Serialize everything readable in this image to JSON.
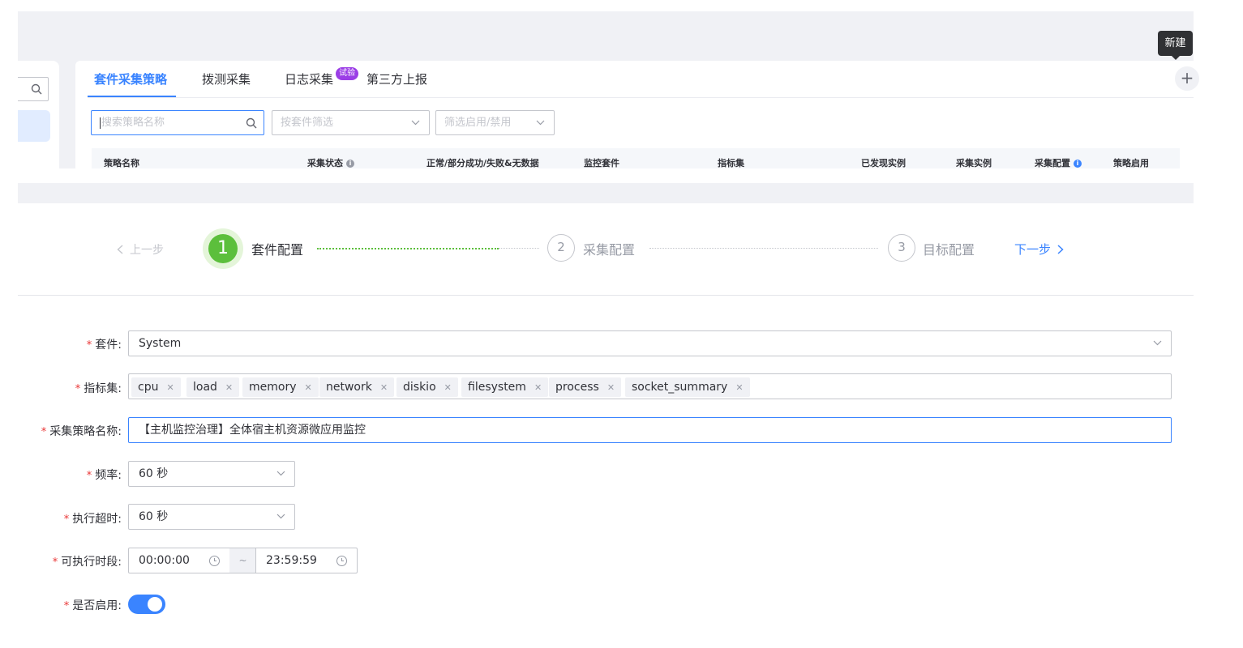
{
  "tooltip": {
    "new": "新建"
  },
  "tabs": [
    {
      "label": "套件采集策略"
    },
    {
      "label": "拨测采集"
    },
    {
      "label": "日志采集"
    },
    {
      "label": "第三方上报"
    }
  ],
  "trial_badge": "试验",
  "plus": "+",
  "filters": {
    "search_placeholder": "搜索策略名称",
    "package_placeholder": "按套件筛选",
    "status_placeholder": "筛选启用/禁用"
  },
  "table": {
    "columns": [
      "策略名称",
      "采集状态",
      "正常/部分成功/失败&无数据",
      "监控套件",
      "指标集",
      "已发现实例",
      "采集实例",
      "采集配置",
      "策略启用"
    ]
  },
  "steps": {
    "prev": "上一步",
    "next": "下一步",
    "items": [
      {
        "num": "1",
        "label": "套件配置"
      },
      {
        "num": "2",
        "label": "采集配置"
      },
      {
        "num": "3",
        "label": "目标配置"
      }
    ]
  },
  "form": {
    "package_label": "套件:",
    "package_value": "System",
    "metrics_label": "指标集:",
    "metrics": [
      "cpu",
      "load",
      "memory",
      "network",
      "diskio",
      "filesystem",
      "process",
      "socket_summary"
    ],
    "name_label": "采集策略名称:",
    "name_value": "【主机监控治理】全体宿主机资源微应用监控",
    "freq_label": "频率:",
    "freq_value": "60 秒",
    "timeout_label": "执行超时:",
    "timeout_value": "60 秒",
    "period_label": "可执行时段:",
    "period_start": "00:00:00",
    "period_sep": "~",
    "period_end": "23:59:59",
    "enable_label": "是否启用:",
    "enable_state": true
  },
  "colors": {
    "primary": "#3a84ff",
    "success": "#5cbf3c",
    "required": "#ea3636",
    "badge": "#9b3ee6"
  }
}
